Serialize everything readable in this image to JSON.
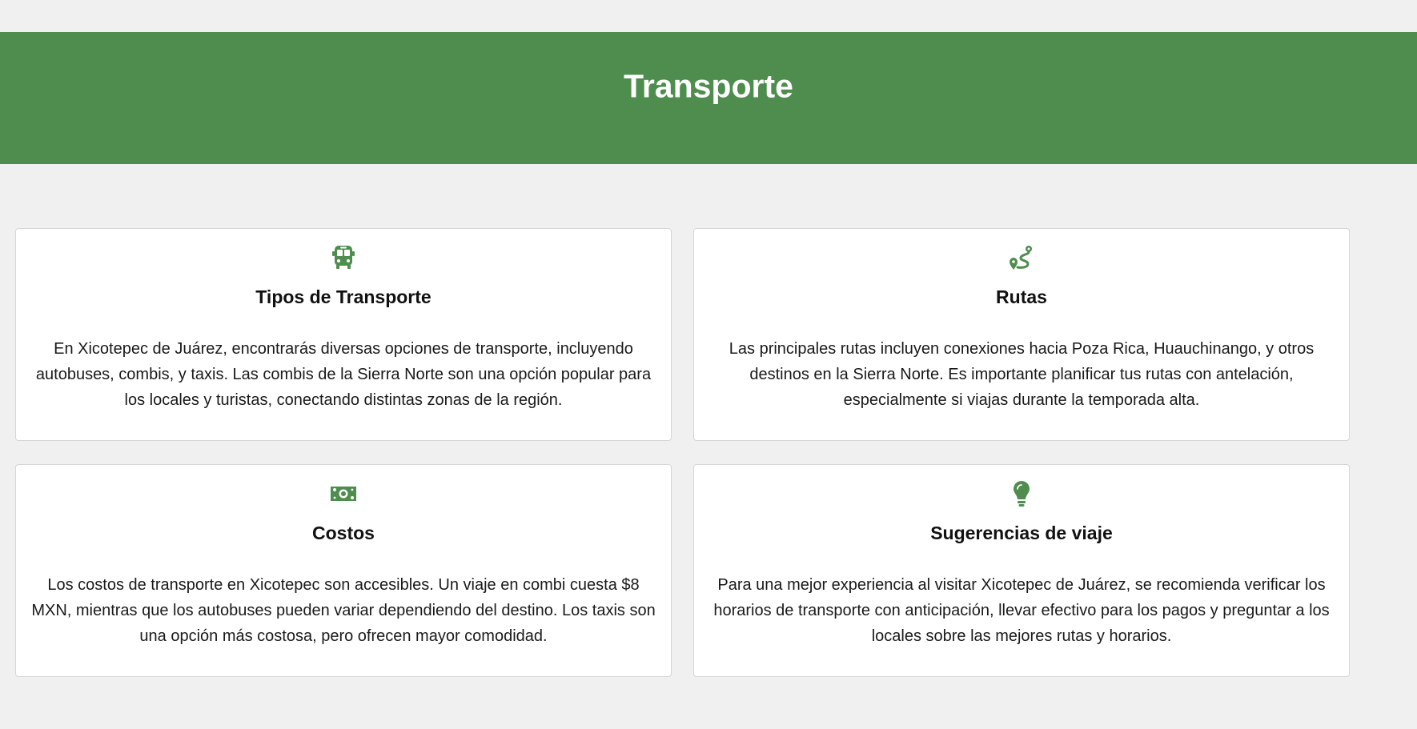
{
  "header": {
    "title": "Transporte"
  },
  "theme": {
    "accent": "#4e8d4e",
    "background": "#f0f0f0",
    "card_background": "#ffffff"
  },
  "cards": [
    {
      "icon": "bus-icon",
      "title": "Tipos de Transporte",
      "text": "En Xicotepec de Juárez, encontrarás diversas opciones de transporte, incluyendo autobuses, combis, y taxis. Las combis de la Sierra Norte son una opción popular para los locales y turistas, conectando distintas zonas de la región."
    },
    {
      "icon": "route-icon",
      "title": "Rutas",
      "text": "Las principales rutas incluyen conexiones hacia Poza Rica, Huauchinango, y otros destinos en la Sierra Norte. Es importante planificar tus rutas con antelación, especialmente si viajas durante la temporada alta."
    },
    {
      "icon": "money-bill-icon",
      "title": "Costos",
      "text": "Los costos de transporte en Xicotepec son accesibles. Un viaje en combi cuesta $8 MXN, mientras que los autobuses pueden variar dependiendo del destino. Los taxis son una opción más costosa, pero ofrecen mayor comodidad."
    },
    {
      "icon": "lightbulb-icon",
      "title": "Sugerencias de viaje",
      "text": "Para una mejor experiencia al visitar Xicotepec de Juárez, se recomienda verificar los horarios de transporte con anticipación, llevar efectivo para los pagos y preguntar a los locales sobre las mejores rutas y horarios."
    }
  ]
}
